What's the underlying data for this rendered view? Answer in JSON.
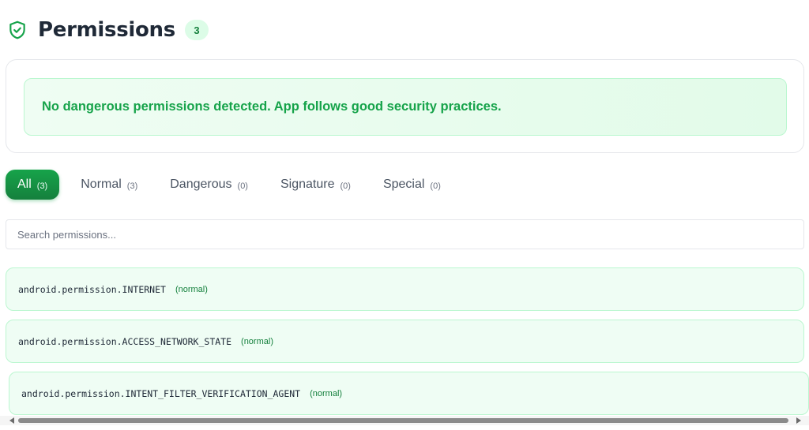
{
  "header": {
    "title": "Permissions",
    "count": "3",
    "icon": "shield-check-icon"
  },
  "summary": {
    "message": "No dangerous permissions detected. App follows good security practices."
  },
  "tabs": [
    {
      "label": "All",
      "count": "(3)",
      "active": true
    },
    {
      "label": "Normal",
      "count": "(3)"
    },
    {
      "label": "Dangerous",
      "count": "(0)"
    },
    {
      "label": "Signature",
      "count": "(0)"
    },
    {
      "label": "Special",
      "count": "(0)"
    }
  ],
  "search": {
    "placeholder": "Search permissions...",
    "value": ""
  },
  "permissions": [
    {
      "name": "android.permission.INTERNET",
      "level": "(normal)"
    },
    {
      "name": "android.permission.ACCESS_NETWORK_STATE",
      "level": "(normal)"
    },
    {
      "name": "android.permission.INTENT_FILTER_VERIFICATION_AGENT",
      "level": "(normal)"
    }
  ],
  "colors": {
    "accent": "#16a34a",
    "accent_dark": "#15803d",
    "success_bg": "#effdf4",
    "success_border": "#bbf7d0"
  }
}
